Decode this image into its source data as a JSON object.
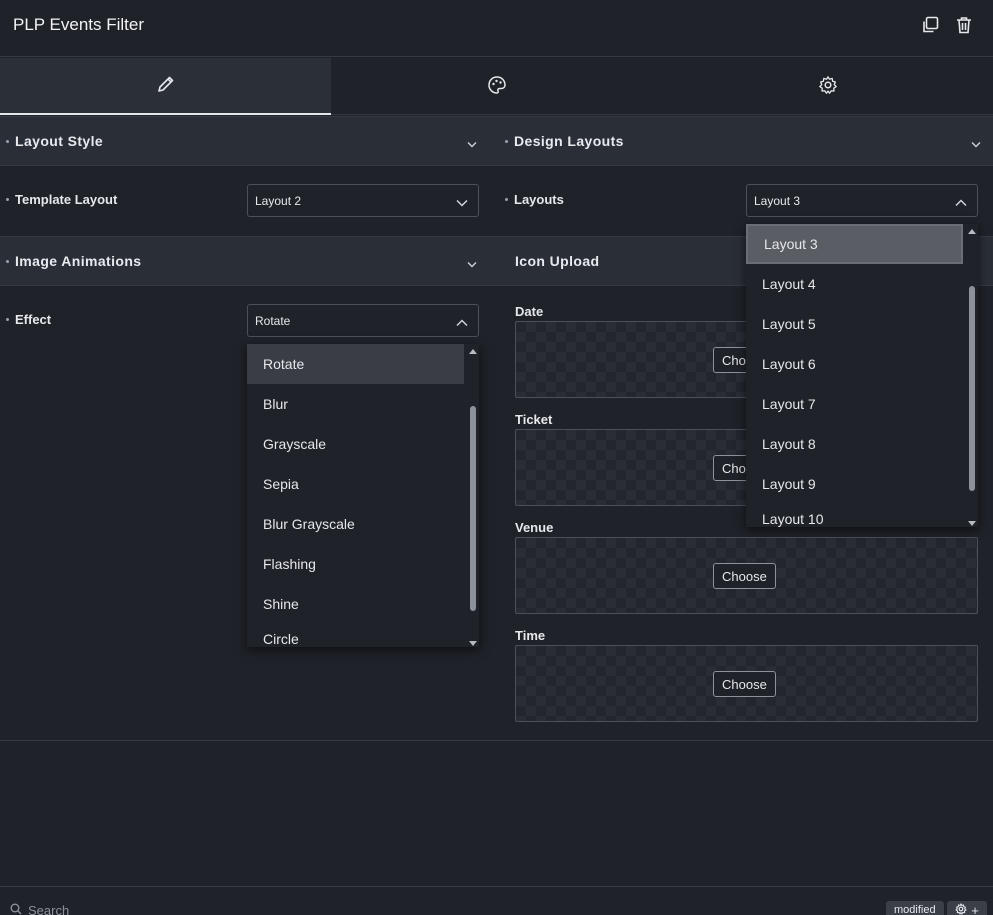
{
  "header": {
    "title": "PLP Events Filter"
  },
  "tabs": [
    {
      "name": "content",
      "icon": "pencil-icon"
    },
    {
      "name": "style",
      "icon": "palette-icon"
    },
    {
      "name": "advanced",
      "icon": "gear-icon"
    }
  ],
  "sections": {
    "layout_style": "Layout Style",
    "design_layouts": "Design Layouts",
    "image_animations": "Image Animations",
    "icon_upload": "Icon Upload"
  },
  "controls": {
    "template_layout": {
      "label": "Template Layout",
      "value": "Layout 2"
    },
    "layouts": {
      "label": "Layouts",
      "value": "Layout 3"
    },
    "effect": {
      "label": "Effect",
      "value": "Rotate"
    }
  },
  "layouts_options": [
    "Layout 3",
    "Layout 4",
    "Layout 5",
    "Layout 6",
    "Layout 7",
    "Layout 8",
    "Layout 9",
    "Layout 10"
  ],
  "effect_options": [
    "Rotate",
    "Blur",
    "Grayscale",
    "Sepia",
    "Blur Grayscale",
    "Flashing",
    "Shine",
    "Circle"
  ],
  "icon_upload": {
    "date": "Date",
    "ticket": "Ticket",
    "venue": "Venue",
    "time": "Time",
    "choose_label": "Choose",
    "choose_partial": "Cho"
  },
  "footer": {
    "search_placeholder": "Search",
    "badge": "modified",
    "plus": "+"
  },
  "colors": {
    "background": "#1f2229",
    "section_header": "#2a2e37",
    "selected_item": "#3a3d45"
  }
}
